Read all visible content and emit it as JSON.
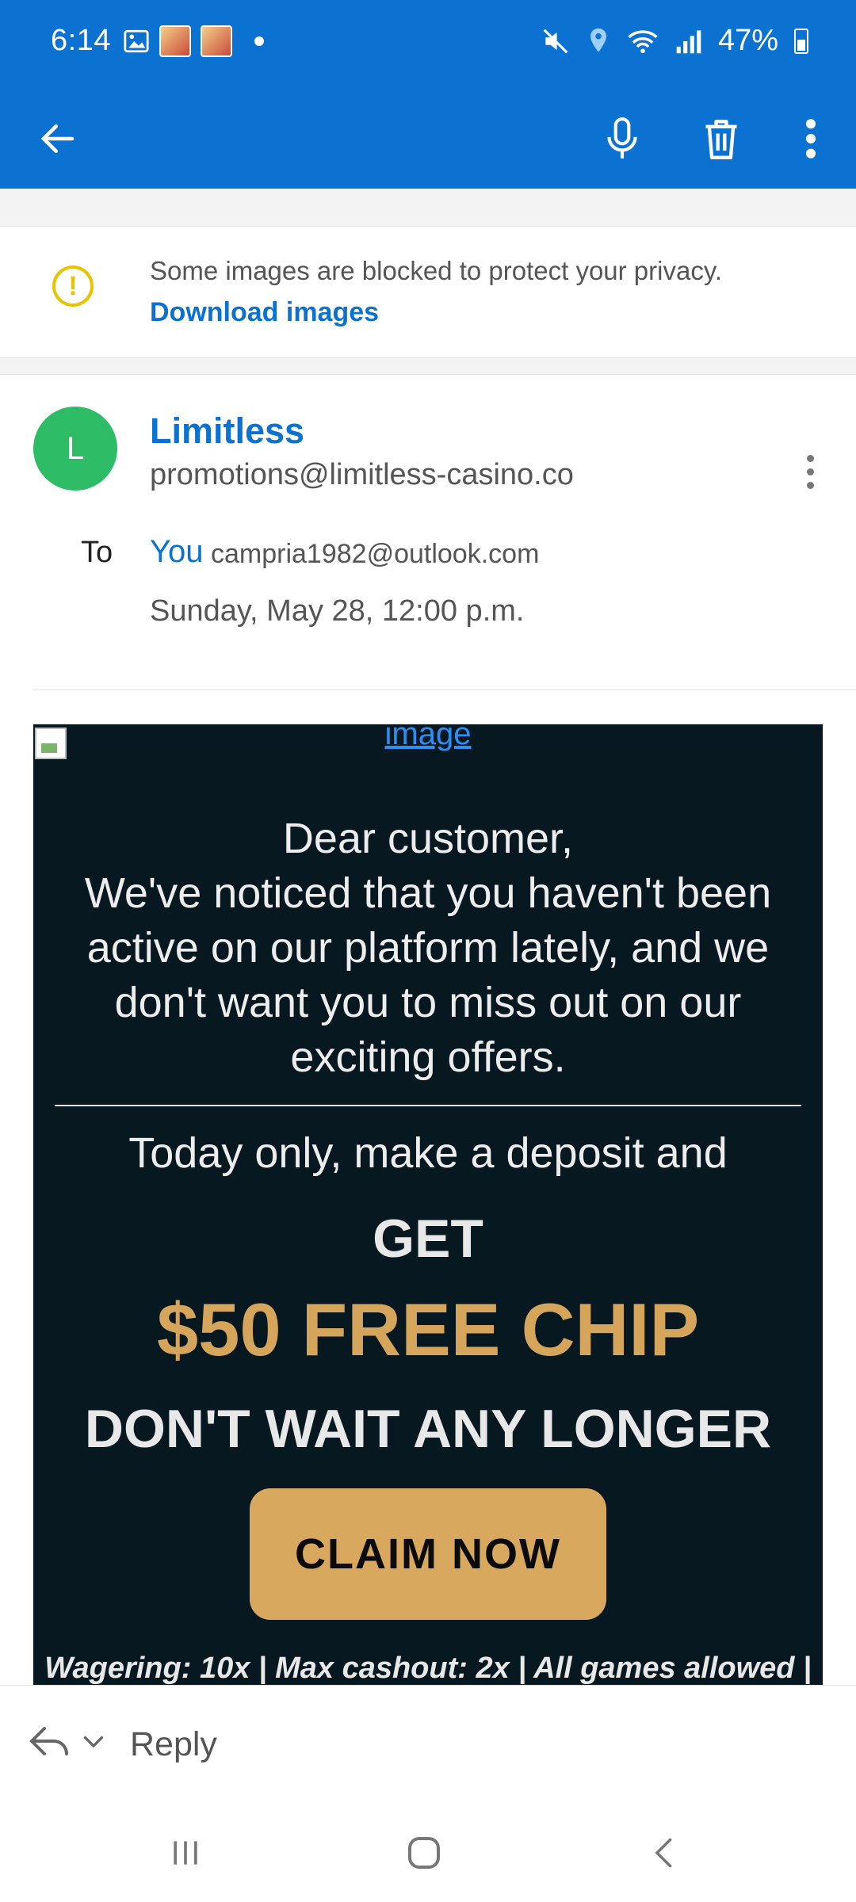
{
  "status": {
    "time": "6:14",
    "battery": "47%",
    "icons": [
      "gallery-icon",
      "app-thumbnail",
      "app-thumbnail",
      "notification-dot",
      "mute-icon",
      "location-icon",
      "wifi-icon",
      "signal-icon",
      "battery-icon"
    ]
  },
  "appbar": {
    "icons": [
      "back-arrow-icon",
      "microphone-icon",
      "trash-icon",
      "more-vert-icon"
    ]
  },
  "notice": {
    "message": "Some images are blocked to protect your privacy.",
    "download_label": "Download images"
  },
  "sender": {
    "avatar_letter": "L",
    "name": "Limitless",
    "email": "promotions@limitless-casino.co"
  },
  "recipient": {
    "to_label": "To",
    "name": "You",
    "email": "campria1982@outlook.com"
  },
  "date": "Sunday, May 28, 12:00 p.m.",
  "email_body": {
    "image_link": "image",
    "greeting": "Dear customer,",
    "message": "We've noticed that you haven't been active on our platform lately, and we don't want you to miss out on our exciting offers.",
    "deposit": "Today only, make a deposit and",
    "get": "GET",
    "offer": "$50 FREE CHIP",
    "urgency": "DON'T WAIT ANY LONGER",
    "cta": "CLAIM NOW",
    "terms": "Wagering: 10x | Max cashout: 2x | All games allowed |"
  },
  "reply": {
    "label": "Reply"
  },
  "colors": {
    "header": "#0b72d2",
    "link": "#0b72d2",
    "avatar": "#2ebd66",
    "email_bg": "#071821",
    "accent_gold": "#d5a55b",
    "button_gold": "#d8a85f",
    "warning": "#e8c300"
  }
}
